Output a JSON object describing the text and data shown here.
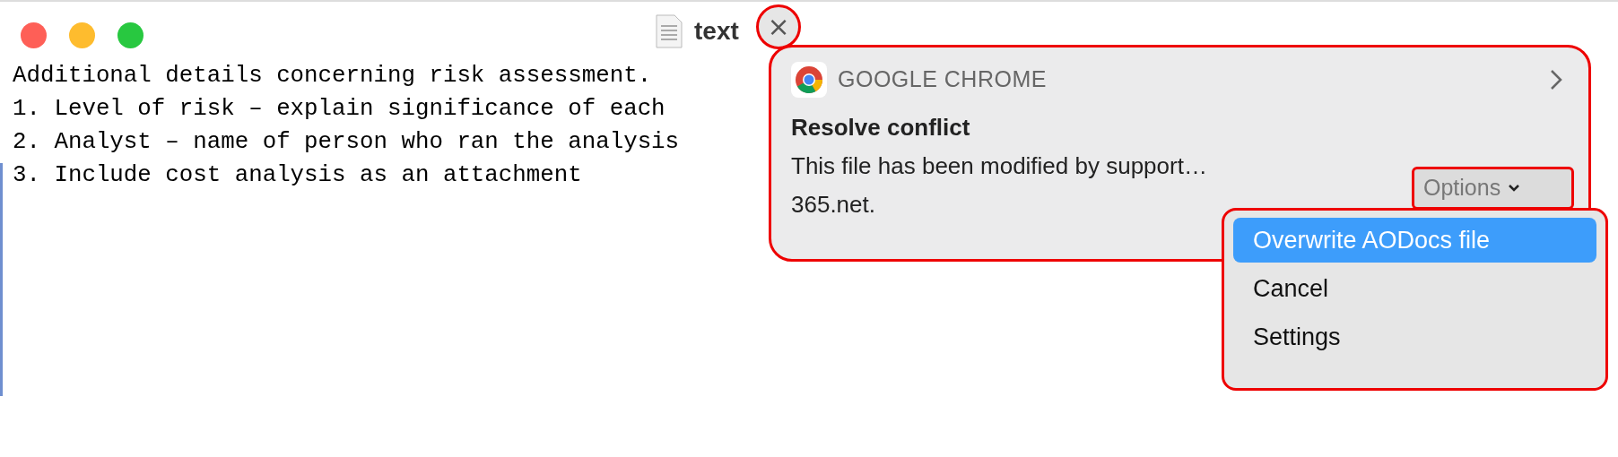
{
  "window": {
    "title": "text"
  },
  "editor": {
    "lines": [
      "Additional details concerning risk assessment.",
      "1. Level of risk – explain significance of each",
      "2. Analyst – name of person who ran the analysis",
      "3. Include cost analysis as an attachment"
    ]
  },
  "notification": {
    "app": "GOOGLE CHROME",
    "title": "Resolve conflict",
    "body_lines": [
      "This file has been modified by support…",
      "365.net."
    ],
    "close": "×",
    "options_button": "Options"
  },
  "options_menu": {
    "items": [
      {
        "label": "Overwrite AODocs file",
        "selected": true
      },
      {
        "label": "Cancel",
        "selected": false
      },
      {
        "label": "Settings",
        "selected": false
      }
    ]
  }
}
